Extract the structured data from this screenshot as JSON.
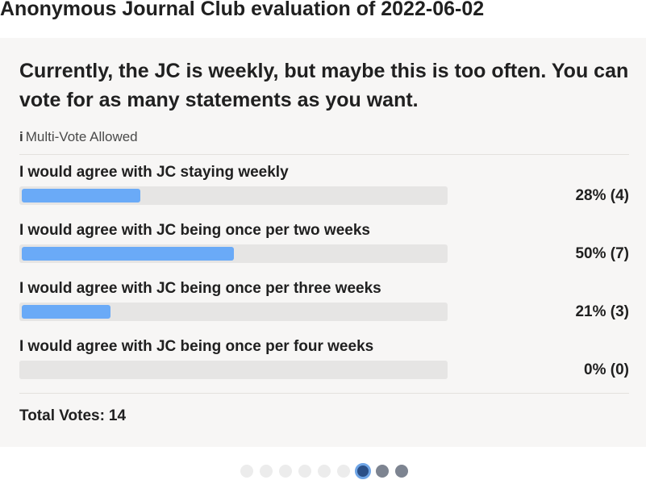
{
  "page_title": "Anonymous Journal Club evaluation of 2022-06-02",
  "poll": {
    "question": "Currently, the JC is weekly, but maybe this is too often. You can vote for as many statements as you want.",
    "multi_vote_icon": "i",
    "multi_vote_label": "Multi-Vote Allowed",
    "options": [
      {
        "label": "I would agree with JC staying weekly",
        "percent": 28,
        "votes": 4,
        "result": "28% (4)"
      },
      {
        "label": "I would agree with JC being once per two weeks",
        "percent": 50,
        "votes": 7,
        "result": "50% (7)"
      },
      {
        "label": "I would agree with JC being once per three weeks",
        "percent": 21,
        "votes": 3,
        "result": "21% (3)"
      },
      {
        "label": "I would agree with JC being once per four weeks",
        "percent": 0,
        "votes": 0,
        "result": "0% (0)"
      }
    ],
    "total_label": "Total Votes:",
    "total_votes": "14"
  },
  "pagination": {
    "count": 9,
    "active_index": 6
  },
  "colors": {
    "bar_fill": "#6aaaf7",
    "bar_track": "#e6e5e4",
    "card_background": "#f7f6f5",
    "active_dot": "#2a4f87"
  }
}
